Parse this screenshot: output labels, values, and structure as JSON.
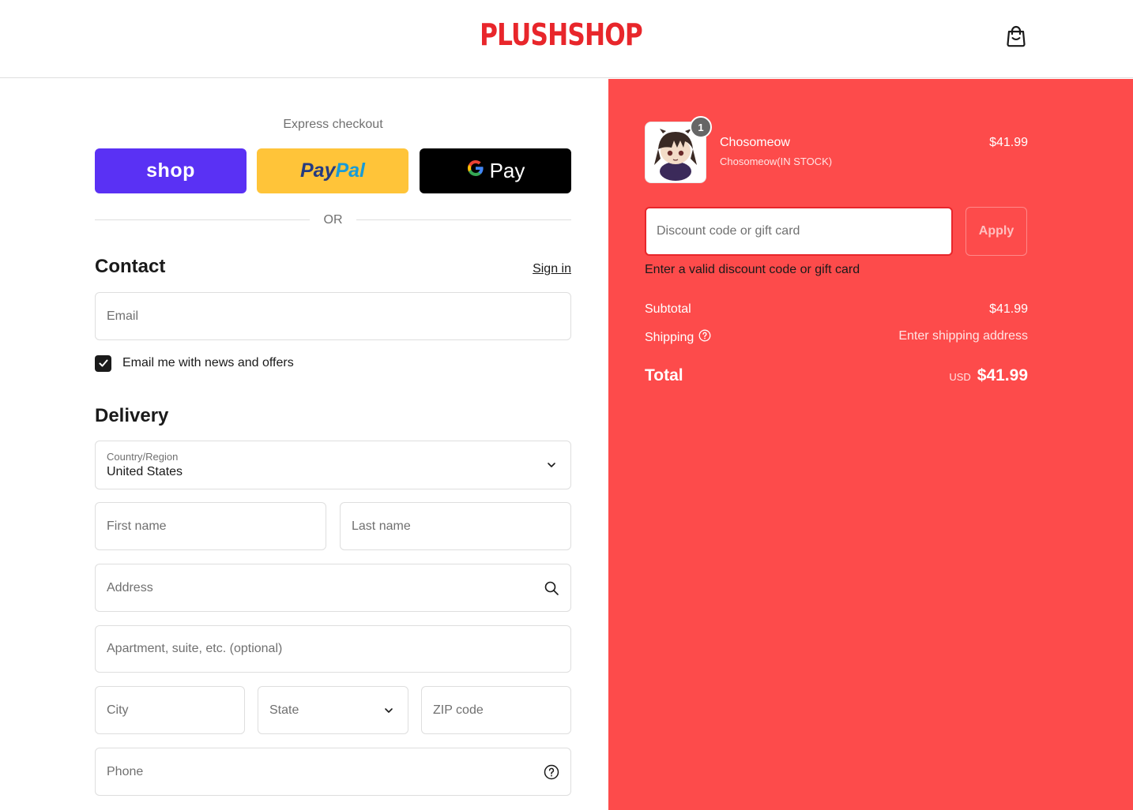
{
  "header": {
    "logo": "PLUSHSHOP",
    "cart_icon": "shopping-bag-icon"
  },
  "express": {
    "title": "Express checkout",
    "shop_label": "shop",
    "paypal_label_1": "Pay",
    "paypal_label_2": "Pal",
    "gpay_label": "Pay",
    "or_label": "OR"
  },
  "contact": {
    "title": "Contact",
    "signin_label": "Sign in",
    "email_placeholder": "Email",
    "newsletter_label": "Email me with news and offers",
    "newsletter_checked": true
  },
  "delivery": {
    "title": "Delivery",
    "country_label": "Country/Region",
    "country_value": "United States",
    "first_name_placeholder": "First name",
    "last_name_placeholder": "Last name",
    "address_placeholder": "Address",
    "apartment_placeholder": "Apartment, suite, etc. (optional)",
    "city_placeholder": "City",
    "state_placeholder": "State",
    "zip_placeholder": "ZIP code",
    "phone_placeholder": "Phone"
  },
  "summary": {
    "product": {
      "name": "Chosomeow",
      "variant": "Chosomeow(IN STOCK)",
      "price": "$41.99",
      "quantity": "1"
    },
    "discount_placeholder": "Discount code or gift card",
    "apply_label": "Apply",
    "discount_error": "Enter a valid discount code or gift card",
    "subtotal_label": "Subtotal",
    "subtotal_value": "$41.99",
    "shipping_label": "Shipping",
    "shipping_value": "Enter shipping address",
    "total_label": "Total",
    "currency": "USD",
    "total_value": "$41.99"
  },
  "colors": {
    "brand": "#e8262b",
    "summary_bg": "#fd4b4b",
    "shop_pay": "#5a31f4",
    "paypal": "#ffc439"
  }
}
